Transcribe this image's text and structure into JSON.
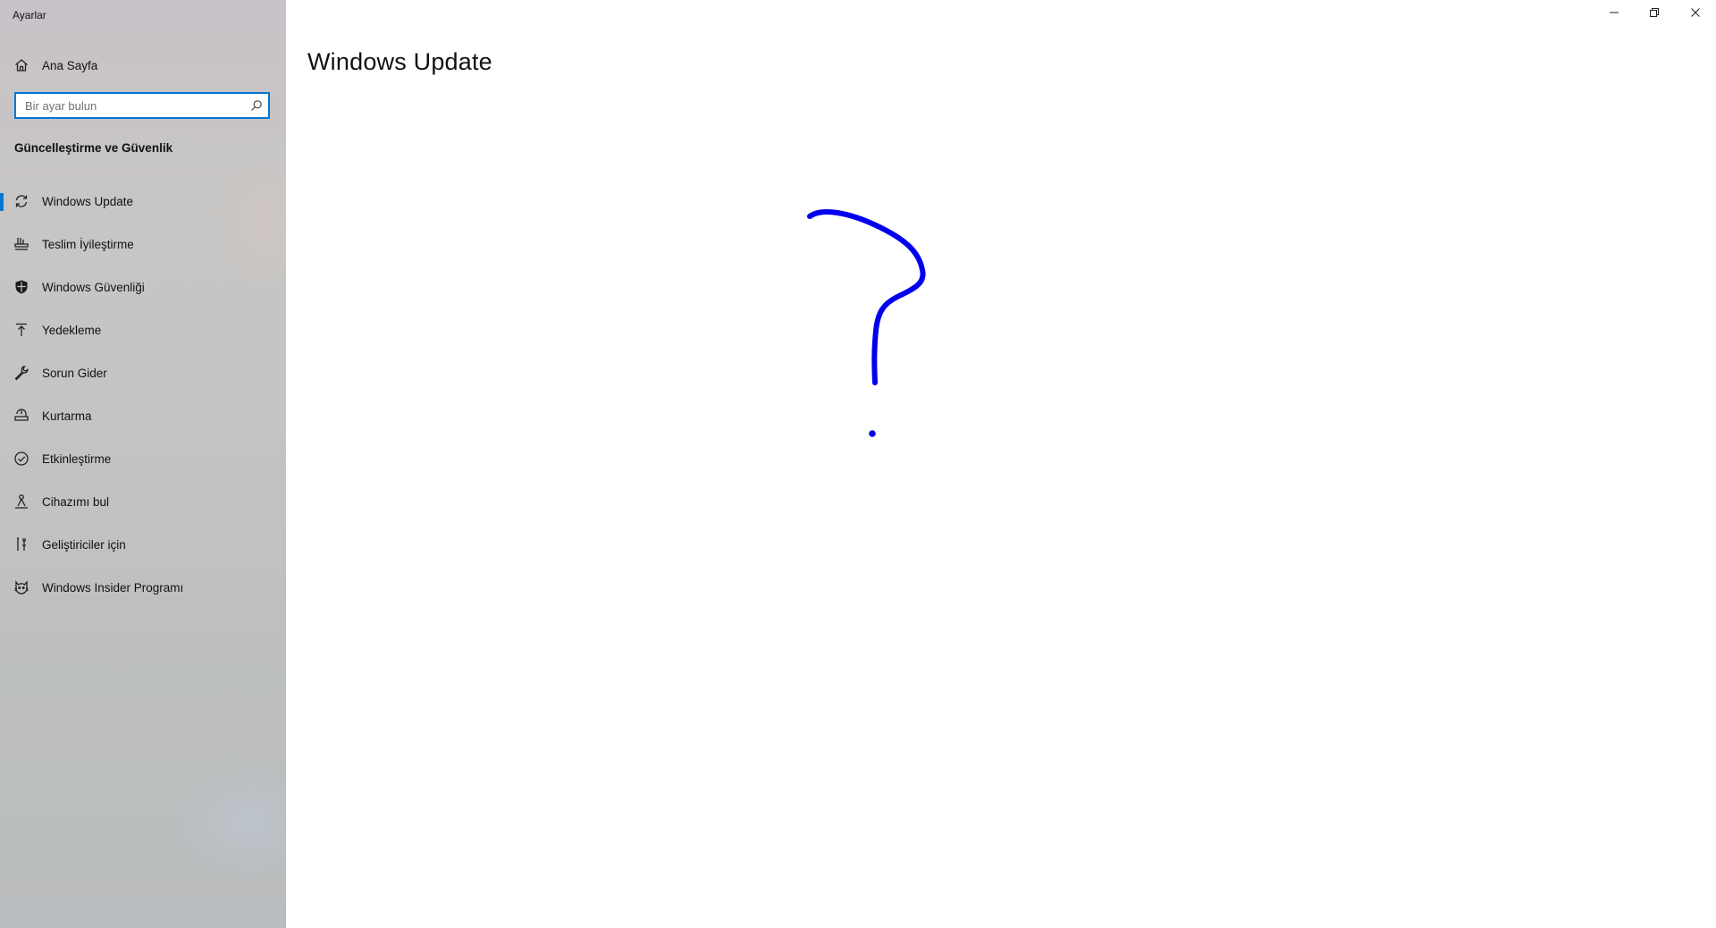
{
  "window": {
    "title": "Ayarlar",
    "controls": {
      "minimize_icon": "minimize-icon",
      "restore_icon": "restore-icon",
      "close_icon": "close-icon"
    }
  },
  "sidebar": {
    "home": {
      "label": "Ana Sayfa",
      "icon": "home-icon"
    },
    "search": {
      "placeholder": "Bir ayar bulun",
      "value": "",
      "icon": "search-icon"
    },
    "section_heading": "Güncelleştirme ve Güvenlik",
    "items": [
      {
        "label": "Windows Update",
        "icon": "refresh-icon",
        "selected": true
      },
      {
        "label": "Teslim İyileştirme",
        "icon": "delivery-optimization-icon",
        "selected": false
      },
      {
        "label": "Windows Güvenliği",
        "icon": "shield-icon",
        "selected": false
      },
      {
        "label": "Yedekleme",
        "icon": "backup-arrow-icon",
        "selected": false
      },
      {
        "label": "Sorun Gider",
        "icon": "wrench-icon",
        "selected": false
      },
      {
        "label": "Kurtarma",
        "icon": "recovery-icon",
        "selected": false
      },
      {
        "label": "Etkinleştirme",
        "icon": "check-circle-icon",
        "selected": false
      },
      {
        "label": "Cihazımı bul",
        "icon": "find-device-icon",
        "selected": false
      },
      {
        "label": "Geliştiriciler için",
        "icon": "developer-tools-icon",
        "selected": false
      },
      {
        "label": "Windows Insider Programı",
        "icon": "insider-cat-icon",
        "selected": false
      }
    ]
  },
  "main": {
    "title": "Windows Update",
    "annotation": {
      "icon": "hand-drawn-question-mark",
      "color": "#0000ee"
    }
  },
  "colors": {
    "accent": "#0078d7",
    "sidebar_bg": "#c6c5c4",
    "main_bg": "#ffffff"
  }
}
